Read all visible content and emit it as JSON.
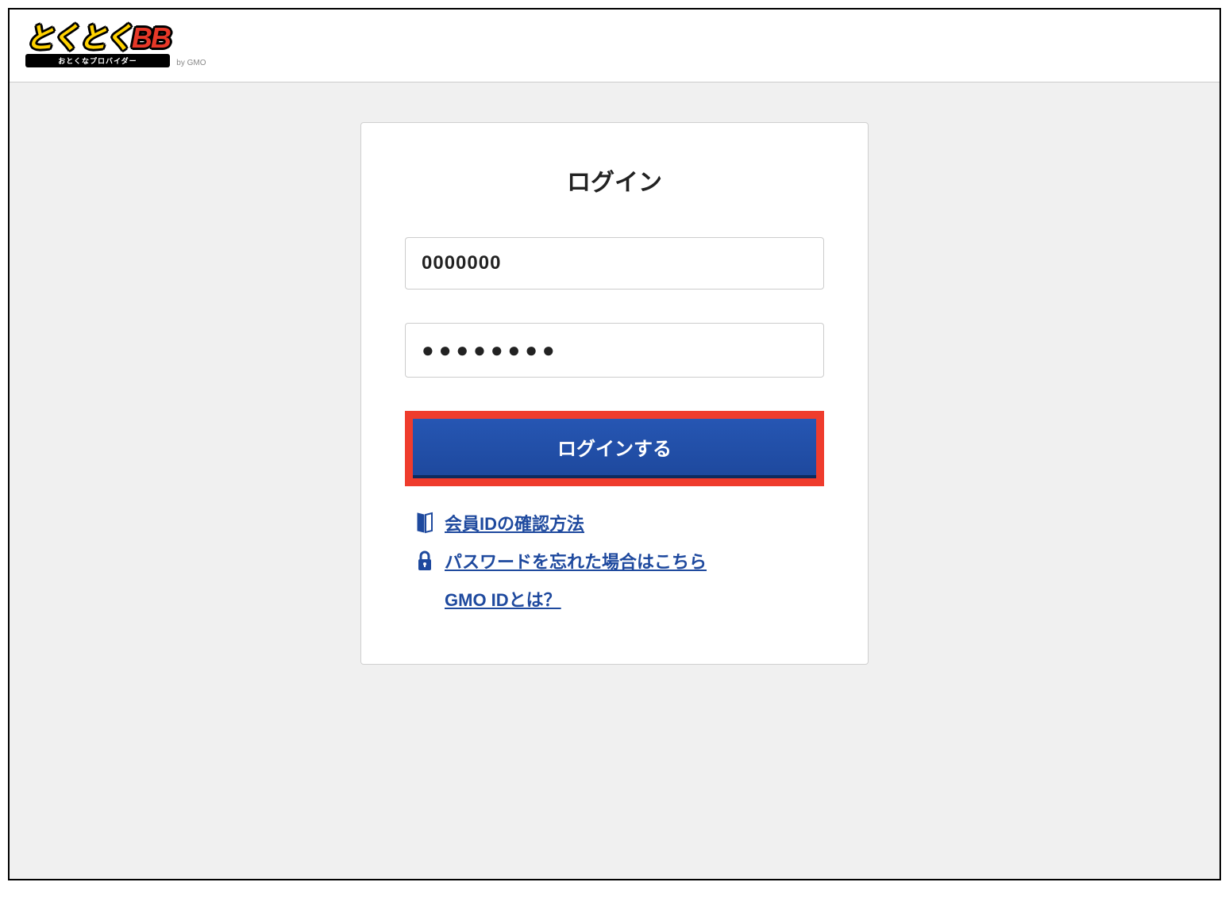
{
  "header": {
    "logo_text_1": "とくとく",
    "logo_text_2": "BB",
    "logo_subtitle": "おとくなプロバイダー",
    "logo_suffix": "by GMO"
  },
  "login": {
    "title": "ログイン",
    "member_id_value": "0000000",
    "password_value": "●●●●●●●●",
    "button_label": "ログインする"
  },
  "links": {
    "confirm_id": "会員IDの確認方法",
    "forgot_password": "パスワードを忘れた場合はこちら",
    "gmo_id_info": "GMO IDとは？"
  },
  "colors": {
    "primary_blue": "#1E499E",
    "highlight_red": "#EF3C2D",
    "logo_yellow": "#FFD200",
    "logo_red": "#E73828"
  }
}
